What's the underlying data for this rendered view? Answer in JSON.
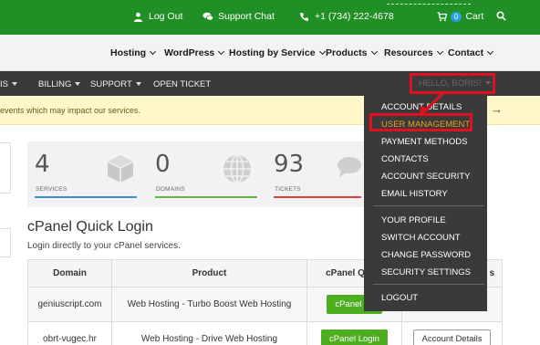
{
  "topbar": {
    "logout": "Log Out",
    "support_chat": "Support Chat",
    "phone": "+1 (734) 222-4678",
    "cart_count": "0",
    "cart": "Cart"
  },
  "mainnav": {
    "items": [
      "Hosting",
      "WordPress",
      "Hosting by Service",
      "Products",
      "Resources",
      "Contact"
    ]
  },
  "clientnav": {
    "partial_left": "IS",
    "billing": "BILLING",
    "support": "SUPPORT",
    "open_ticket": "OPEN TICKET",
    "hello": "HELLO, BORIS!"
  },
  "alert": {
    "text": "events which may impact our services."
  },
  "stats": {
    "services_count": "4",
    "services_label": "SERVICES",
    "domains_count": "0",
    "domains_label": "DOMAINS",
    "tickets_count": "93",
    "tickets_label": "TICKETS"
  },
  "cpanel": {
    "title": "cPanel Quick Login",
    "description": "Login directly to your cPanel services.",
    "headers": [
      "Domain",
      "Product",
      "cPanel Quick",
      "s"
    ],
    "rows": [
      {
        "domain": "geniuscript.com",
        "product": "Web Hosting - Turbo Boost Web Hosting",
        "login": "cPanel Lo"
      },
      {
        "domain": "obrt-vugec.hr",
        "product": "Web Hosting - Drive Web Hosting",
        "login": "cPanel Login",
        "details": "Account Details"
      }
    ]
  },
  "dropdown": {
    "items": [
      "ACCOUNT DETAILS",
      "USER MANAGEMENT",
      "PAYMENT METHODS",
      "CONTACTS",
      "ACCOUNT SECURITY",
      "EMAIL HISTORY",
      "YOUR PROFILE",
      "SWITCH ACCOUNT",
      "CHANGE PASSWORD",
      "SECURITY SETTINGS",
      "LOGOUT"
    ]
  },
  "colors": {
    "green": "#1f8f26",
    "highlight_red": "#e0101e",
    "highlight_orange": "#f29c1f",
    "cpanel_button": "#4dae1f"
  }
}
